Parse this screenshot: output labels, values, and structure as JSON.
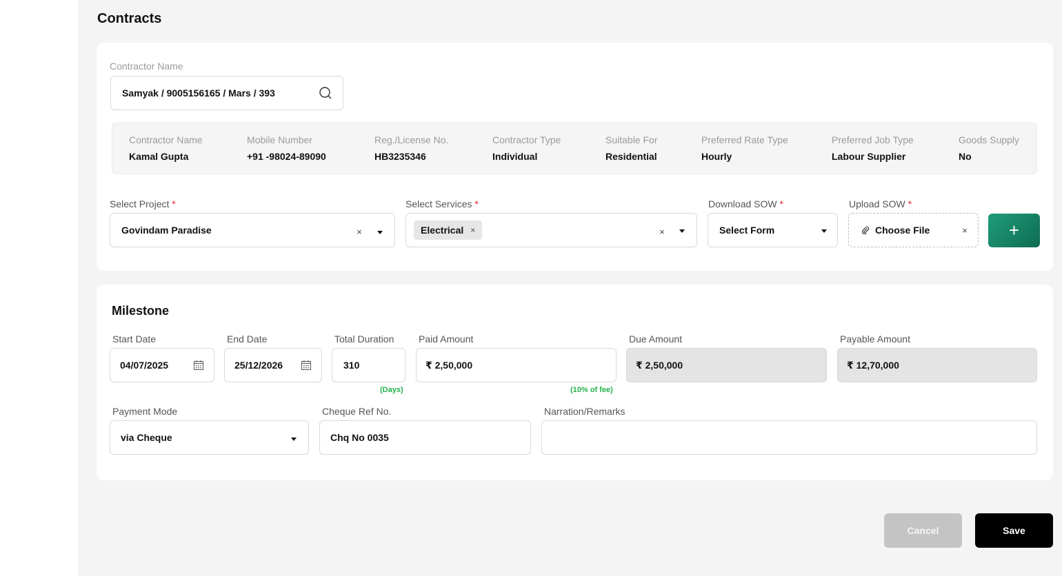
{
  "page": {
    "title": "Contracts"
  },
  "contractor_search": {
    "label": "Contractor Name",
    "value": "Samyak / 9005156165 / Mars / 393"
  },
  "contractor_info": [
    {
      "key": "Contractor Name",
      "value": "Kamal Gupta"
    },
    {
      "key": "Mobile Number",
      "value": "+91 -98024-89090"
    },
    {
      "key": "Reg./License No.",
      "value": "HB3235346"
    },
    {
      "key": "Contractor Type",
      "value": "Individual"
    },
    {
      "key": "Suitable For",
      "value": "Residential"
    },
    {
      "key": "Preferred Rate Type",
      "value": "Hourly"
    },
    {
      "key": "Preferred Job Type",
      "value": "Labour Supplier"
    },
    {
      "key": "Goods Supply",
      "value": "No"
    }
  ],
  "project": {
    "label": "Select Project",
    "required": "*",
    "value": "Govindam Paradise",
    "clear": "×"
  },
  "services": {
    "label": "Select Services",
    "required": "*",
    "chips": [
      "Electrical"
    ],
    "chip_remove": "×",
    "clear": "×"
  },
  "download_sow": {
    "label": "Download SOW",
    "required": "*",
    "value": "Select Form"
  },
  "upload_sow": {
    "label": "Upload SOW",
    "required": "*",
    "value": "Choose File",
    "clear": "×"
  },
  "add_button": {
    "label": "+"
  },
  "milestone": {
    "title": "Milestone",
    "start_date": {
      "label": "Start Date",
      "value": "04/07/2025"
    },
    "end_date": {
      "label": "End Date",
      "value": "25/12/2026"
    },
    "total_duration": {
      "label": "Total Duration",
      "value": "310",
      "hint": "(Days)"
    },
    "paid_amount": {
      "label": "Paid Amount",
      "value": "₹ 2,50,000",
      "hint": "(10% of fee)"
    },
    "due_amount": {
      "label": "Due Amount",
      "value": "₹ 2,50,000"
    },
    "payable_amount": {
      "label": "Payable Amount",
      "value": "₹ 12,70,000"
    },
    "payment_mode": {
      "label": "Payment Mode",
      "value": "via Cheque"
    },
    "cheque_ref": {
      "label": "Cheque Ref No.",
      "value": "Chq No 0035"
    },
    "narration": {
      "label": "Narration/Remarks",
      "value": ""
    }
  },
  "actions": {
    "cancel": "Cancel",
    "save": "Save"
  },
  "colors": {
    "accent_green": "#1f9d78",
    "required_red": "#e5252a",
    "hint_green": "#20b24a"
  },
  "icons": {
    "search": "search-icon",
    "calendar": "calendar-icon",
    "clip": "paperclip-icon",
    "caret": "chevron-down-icon",
    "clear": "close-icon"
  }
}
